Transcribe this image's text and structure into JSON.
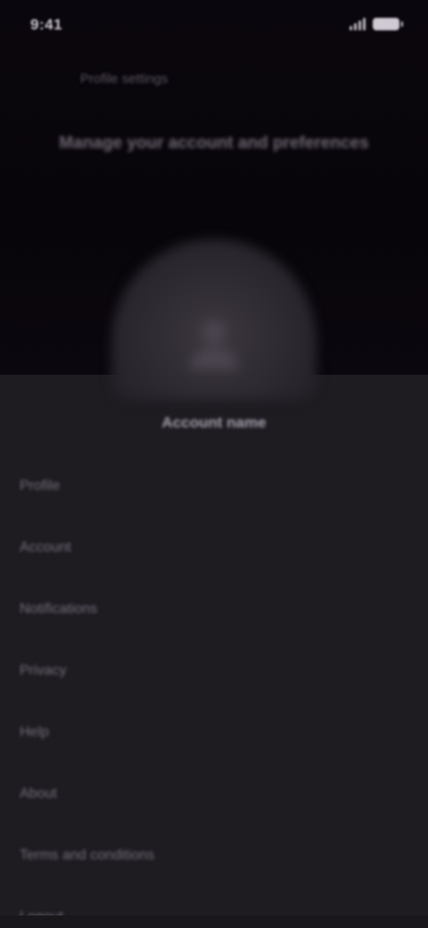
{
  "status_bar": {
    "time": "9:41",
    "signal_icon": "signal-icon",
    "battery_icon": "battery-icon"
  },
  "header": {
    "label": "Profile settings",
    "headline": "Manage your account and preferences"
  },
  "profile": {
    "avatar_icon": "user-icon",
    "name": "Account name"
  },
  "menu": {
    "items": [
      {
        "label": "Profile"
      },
      {
        "label": "Account"
      },
      {
        "label": "Notifications"
      },
      {
        "label": "Privacy"
      },
      {
        "label": "Help"
      },
      {
        "label": "About"
      },
      {
        "label": "Terms and conditions"
      },
      {
        "label": "Logout"
      }
    ]
  },
  "colors": {
    "background": "#1e1b21",
    "top_background": "#08050a",
    "text": "#d8d4dc"
  }
}
